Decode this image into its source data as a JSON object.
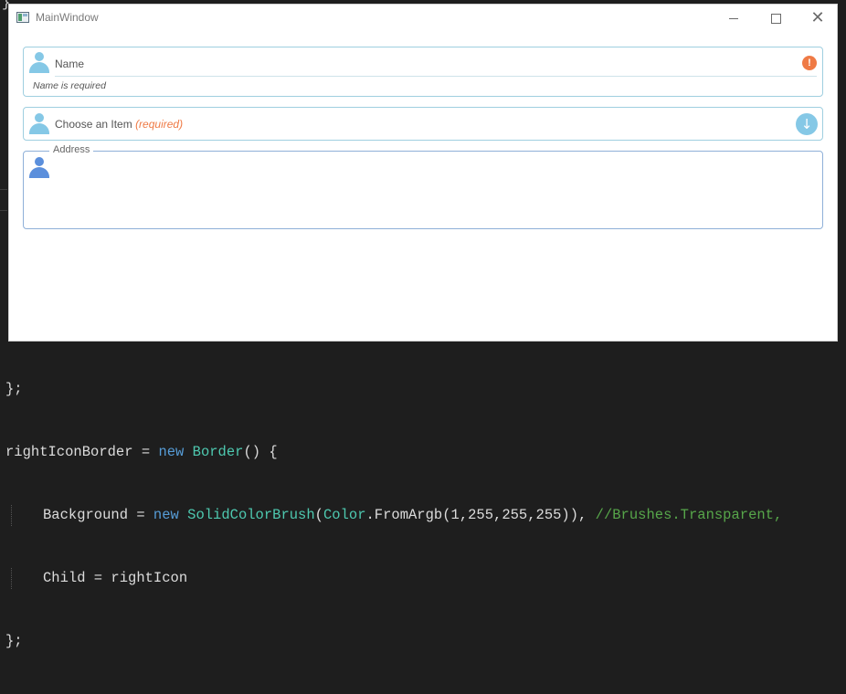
{
  "window": {
    "title": "MainWindow",
    "controls": {
      "minimize_icon": "minimize-icon",
      "maximize_icon": "maximize-icon",
      "close_icon": "close-icon",
      "close_glyph": "✕"
    }
  },
  "form": {
    "name_field": {
      "label": "Name",
      "helper": "Name is required",
      "icon": "person-icon",
      "status_icon": "error-icon",
      "status_glyph": "!",
      "status_color": "#ef7a45"
    },
    "choose_field": {
      "label": "Choose an Item",
      "required_text": "(required)",
      "icon": "person-icon",
      "dropdown_icon": "arrow-down-circle-icon",
      "dropdown_glyph": "↓"
    },
    "address_field": {
      "legend": "Address",
      "value": "",
      "icon": "person-icon"
    }
  },
  "code_editor": {
    "partial_top_chars": "}",
    "lines": [
      "};",
      "rightIconBorder = new Border() {",
      "Background = new SolidColorBrush(Color.FromArgb(1,255,255,255)), //Brushes.Transparent,",
      "Child = rightIcon",
      "};"
    ]
  },
  "colors": {
    "accent": "#85c8e6",
    "error": "#ef7a45",
    "address_icon": "#5b8fdc",
    "editor_bg": "#1e1e1e"
  }
}
